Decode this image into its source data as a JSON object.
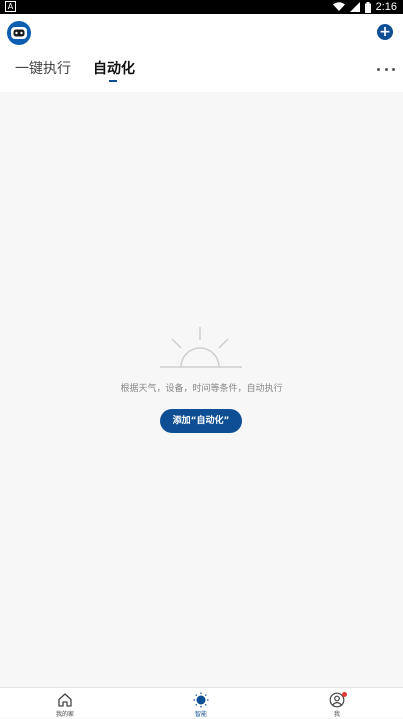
{
  "status_bar": {
    "time": "2:16",
    "notification_icon": "a-notification-icon",
    "icons": [
      "wifi-icon",
      "signal-icon",
      "battery-icon"
    ]
  },
  "header": {
    "avatar_icon": "robot-avatar-icon",
    "add_icon": "plus-circle-icon",
    "tabs": [
      {
        "label": "一键执行",
        "active": false
      },
      {
        "label": "自动化",
        "active": true
      }
    ],
    "more_icon": "more-horizontal-icon"
  },
  "empty_state": {
    "icon": "sunrise-icon",
    "message": "根据天气，设备，时间等条件，自动执行",
    "button_label": "添加“自动化”"
  },
  "bottom_nav": {
    "items": [
      {
        "label": "我的家",
        "icon": "home-icon",
        "active": false
      },
      {
        "label": "智能",
        "icon": "smart-sun-icon",
        "active": true
      },
      {
        "label": "我",
        "icon": "profile-icon",
        "active": false,
        "badge": true
      }
    ]
  },
  "colors": {
    "accent": "#0e4e95",
    "background": "#f7f7f7",
    "badge": "#e53935"
  }
}
